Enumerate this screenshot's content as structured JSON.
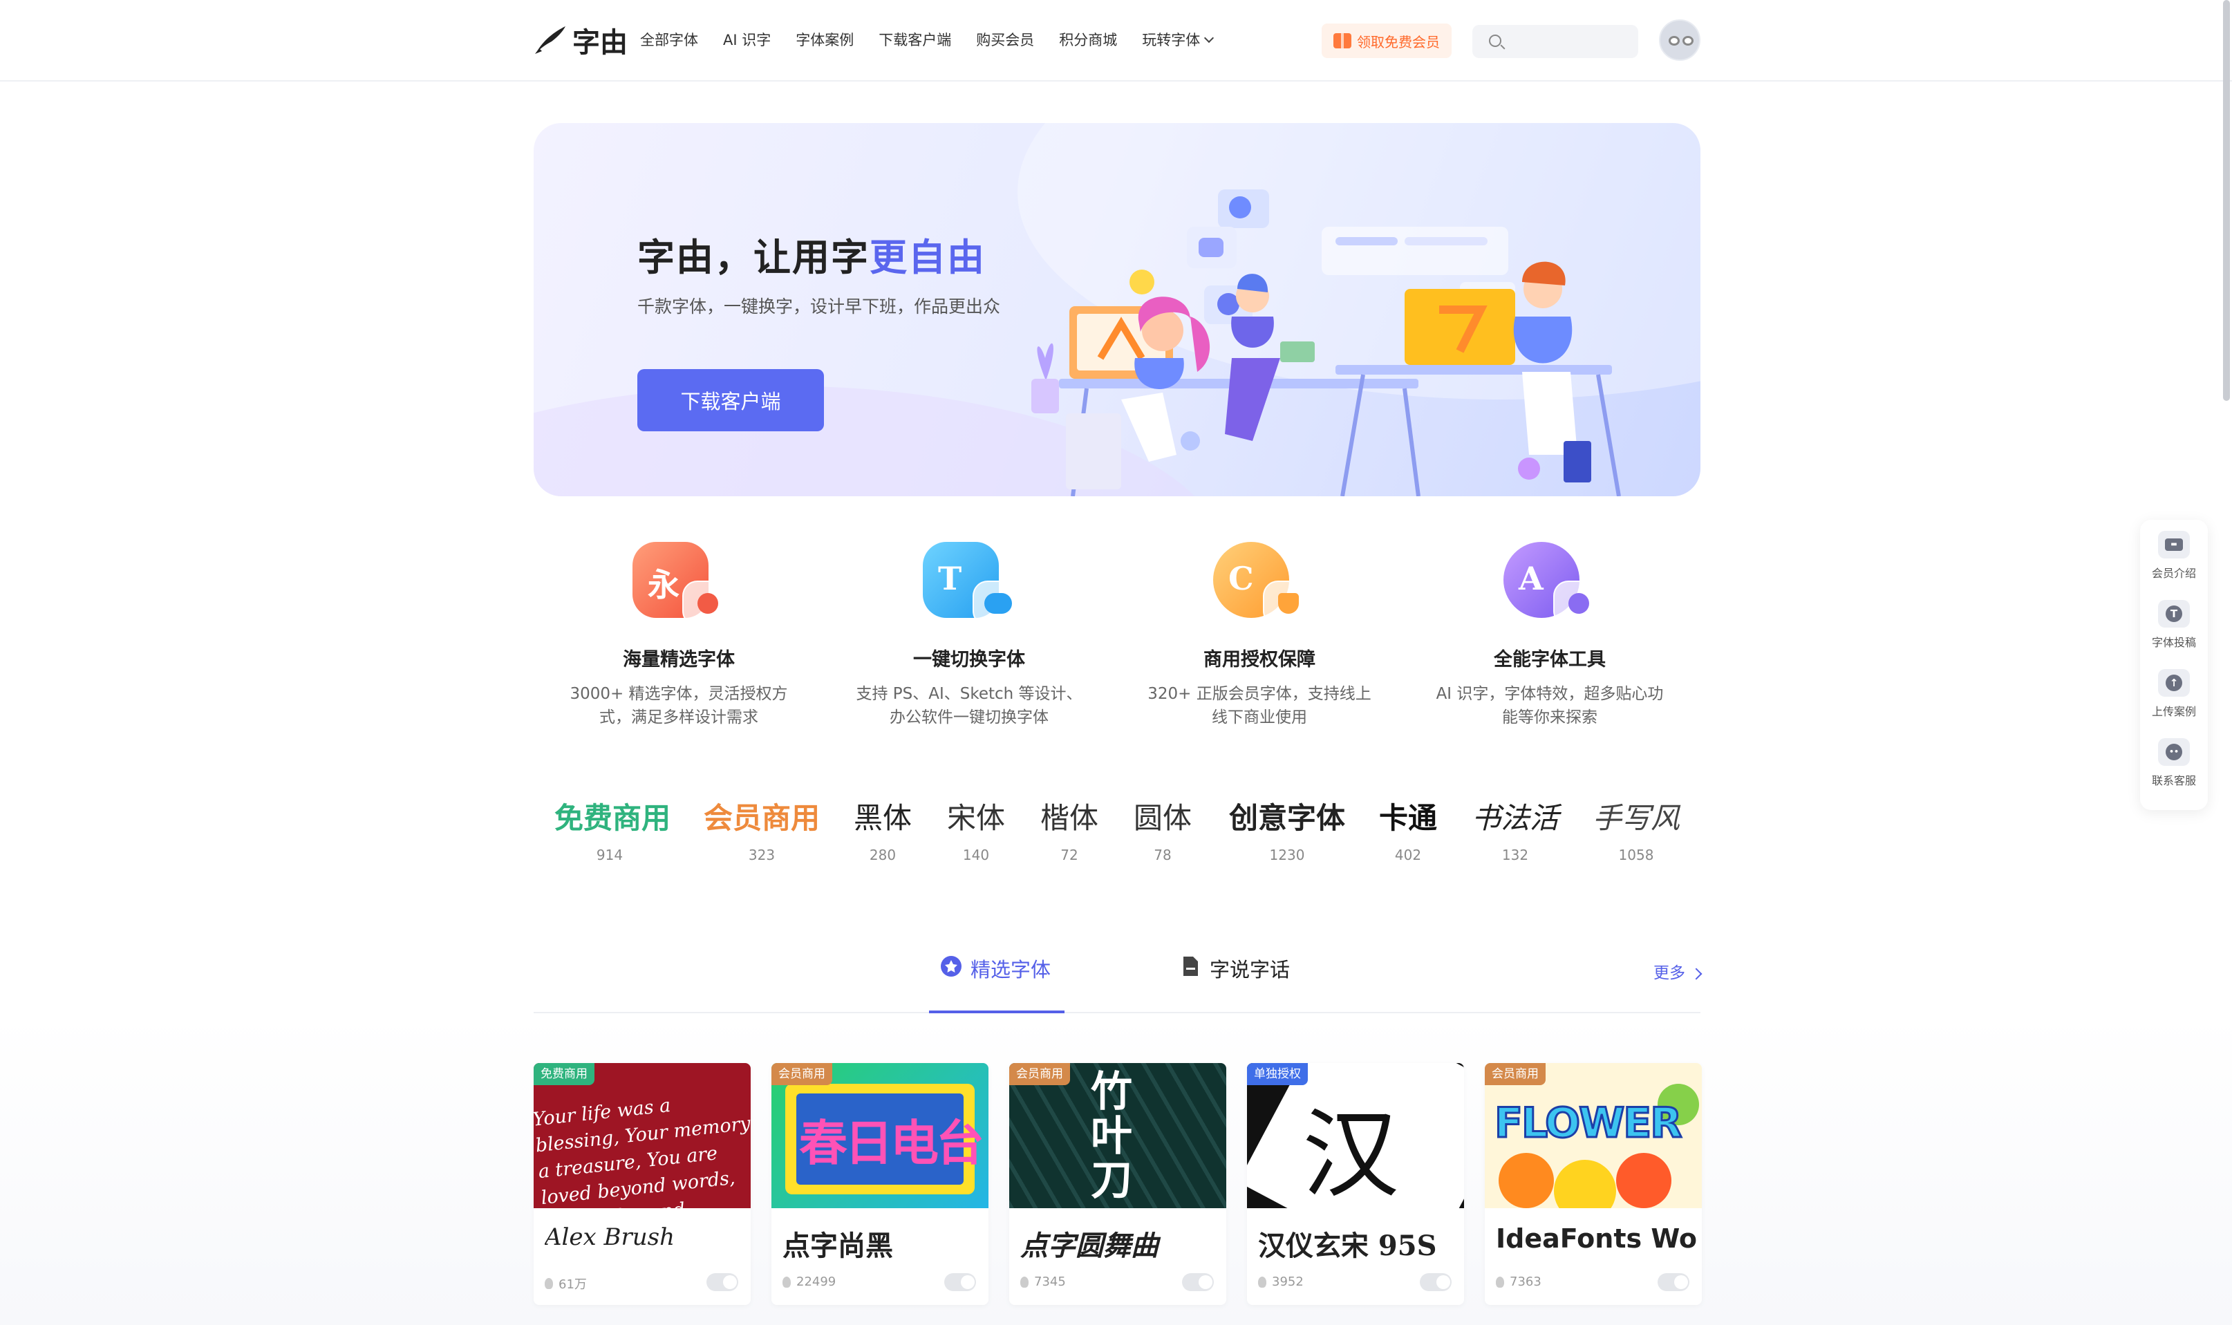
{
  "header": {
    "logo_text": "字由",
    "nav": [
      {
        "label": "全部字体"
      },
      {
        "label": "AI 识字"
      },
      {
        "label": "字体案例"
      },
      {
        "label": "下载客户端"
      },
      {
        "label": "购买会员"
      },
      {
        "label": "积分商城"
      },
      {
        "label": "玩转字体"
      }
    ],
    "vip_button": "领取免费会员",
    "search_placeholder": ""
  },
  "hero": {
    "title_main": "字由，让用字",
    "title_highlight": "更自由",
    "subtitle": "千款字体，一键换字，设计早下班，作品更出众",
    "button": "下载客户端"
  },
  "features": [
    {
      "icon": "font-library-icon",
      "glyph": "永",
      "title": "海量精选字体",
      "desc": "3000+ 精选字体，灵活授权方式，满足多样设计需求"
    },
    {
      "icon": "font-switch-icon",
      "glyph": "T",
      "title": "一键切换字体",
      "desc": "支持 PS、AI、Sketch 等设计、办公软件一键切换字体"
    },
    {
      "icon": "license-shield-icon",
      "glyph": "C",
      "title": "商用授权保障",
      "desc": "320+ 正版会员字体，支持线上线下商业使用"
    },
    {
      "icon": "toolbox-icon",
      "glyph": "A",
      "title": "全能字体工具",
      "desc": "AI 识字，字体特效，超多贴心功能等你来探索"
    }
  ],
  "categories": [
    {
      "name": "免费商用",
      "count": "914"
    },
    {
      "name": "会员商用",
      "count": "323"
    },
    {
      "name": "黑体",
      "count": "280"
    },
    {
      "name": "宋体",
      "count": "140"
    },
    {
      "name": "楷体",
      "count": "72"
    },
    {
      "name": "圆体",
      "count": "78"
    },
    {
      "name": "创意字体",
      "count": "1230"
    },
    {
      "name": "卡通",
      "count": "402"
    },
    {
      "name": "书法活",
      "count": "132"
    },
    {
      "name": "手写风",
      "count": "1058"
    }
  ],
  "tabs": [
    {
      "label": "精选字体",
      "active": true
    },
    {
      "label": "字说字话",
      "active": false
    }
  ],
  "more": "更多",
  "cards": [
    {
      "tag": "免费商用",
      "name": "Alex Brush",
      "count": "61万",
      "thumb_text": "Your life was a blessing, Your memory a treasure, You are loved beyond words, Missed beyond measure"
    },
    {
      "tag": "会员商用",
      "name": "点字尚黑",
      "count": "22499",
      "thumb_text": "春日电台"
    },
    {
      "tag": "会员商用",
      "name": "点字圆舞曲",
      "count": "7345",
      "thumb_text": "竹叶刀"
    },
    {
      "tag": "单独授权",
      "name": "汉仪玄宋 95S",
      "count": "3952",
      "thumb_text": "汉"
    },
    {
      "tag": "会员商用",
      "name": "IdeaFonts Wo",
      "count": "7363",
      "thumb_text": "FLOWER"
    }
  ],
  "side": [
    {
      "label": "会员介绍",
      "glyph": "▬"
    },
    {
      "label": "字体投稿",
      "glyph": "T"
    },
    {
      "label": "上传案例",
      "glyph": "↑"
    },
    {
      "label": "联系客服",
      "glyph": "••"
    }
  ],
  "colors": {
    "accent": "#5560e8",
    "hero_button": "#5b6bf2",
    "vip_orange": "#ff6a2c",
    "free_green": "#2fb37e",
    "member_orange": "#ee8a3c"
  }
}
